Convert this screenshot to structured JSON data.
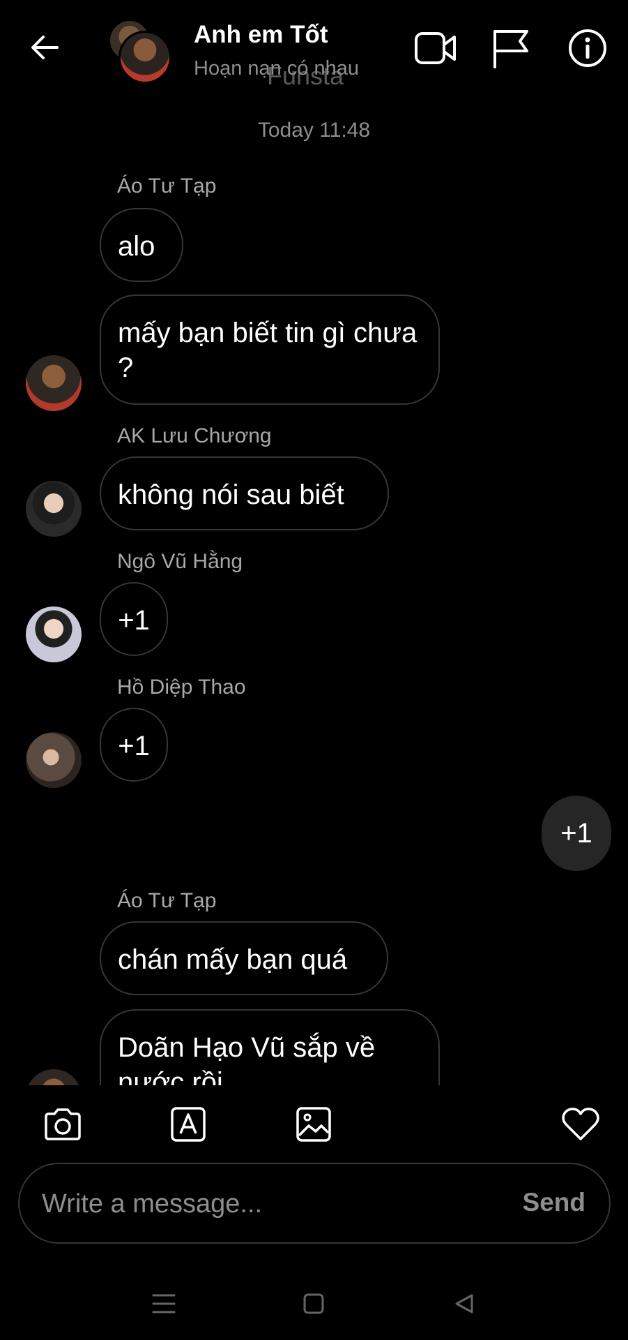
{
  "header": {
    "title": "Anh em Tốt",
    "subtitle": "Hoạn nạn có nhau",
    "ghost_text": "Funsta"
  },
  "thread": {
    "timestamp": "Today 11:48",
    "messages": [
      {
        "sender": "Áo Tư Tạp",
        "text": "alo"
      },
      {
        "text": "mấy bạn  biết tin gì chưa ?"
      },
      {
        "sender": "AK Lưu Chương",
        "text": "không nói sau biết"
      },
      {
        "sender": "Ngô Vũ Hằng",
        "text": "+1"
      },
      {
        "sender": "Hồ Diệp Thao",
        "text": "+1"
      },
      {
        "mine": true,
        "text": "+1"
      },
      {
        "sender": "Áo Tư Tạp",
        "text": "chán mấy bạn quá"
      },
      {
        "text": "Doãn Hạo Vũ sắp về nước rồi"
      }
    ]
  },
  "composer": {
    "placeholder": "Write a message...",
    "send_label": "Send"
  },
  "icons": {
    "back": "arrow-left-icon",
    "video": "video-camera-icon",
    "report": "flag-icon",
    "info": "info-icon",
    "camera": "camera-icon",
    "sticker": "sticker-icon",
    "gallery": "image-icon",
    "like": "heart-icon"
  }
}
